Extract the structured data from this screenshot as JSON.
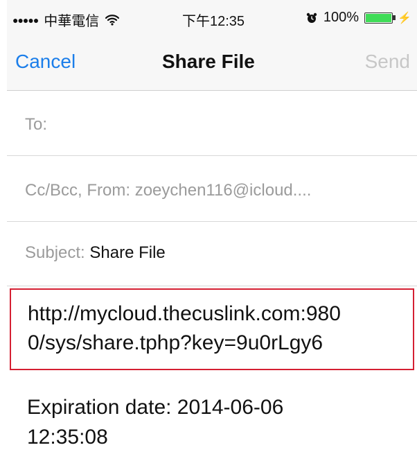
{
  "status_bar": {
    "signal": "●●●●●",
    "carrier": "中華電信",
    "wifi_icon": "wifi-icon",
    "time": "下午12:35",
    "alarm_icon": "alarm-icon",
    "battery_percent": "100%",
    "battery_level": 1.0,
    "battery_color": "#3fdc57",
    "charging_icon": "⚡"
  },
  "nav": {
    "cancel_label": "Cancel",
    "title": "Share File",
    "send_label": "Send",
    "accent_color": "#1b7eea",
    "disabled_color": "#c7c7c7"
  },
  "fields": {
    "to_label": "To:",
    "cc_label": "Cc/Bcc, From:",
    "from_email": "zoeychen116@icloud....",
    "subject_label": "Subject:",
    "subject_value": "Share File"
  },
  "body": {
    "link_line_1": "http://mycloud.thecuslink.com:980",
    "link_line_2": "0/sys/share.tphp?key=9u0rLgy6",
    "expiration_line_1": "Expiration date: 2014-06-06",
    "expiration_line_2": "12:35:08",
    "highlight_color": "#d51f32"
  }
}
